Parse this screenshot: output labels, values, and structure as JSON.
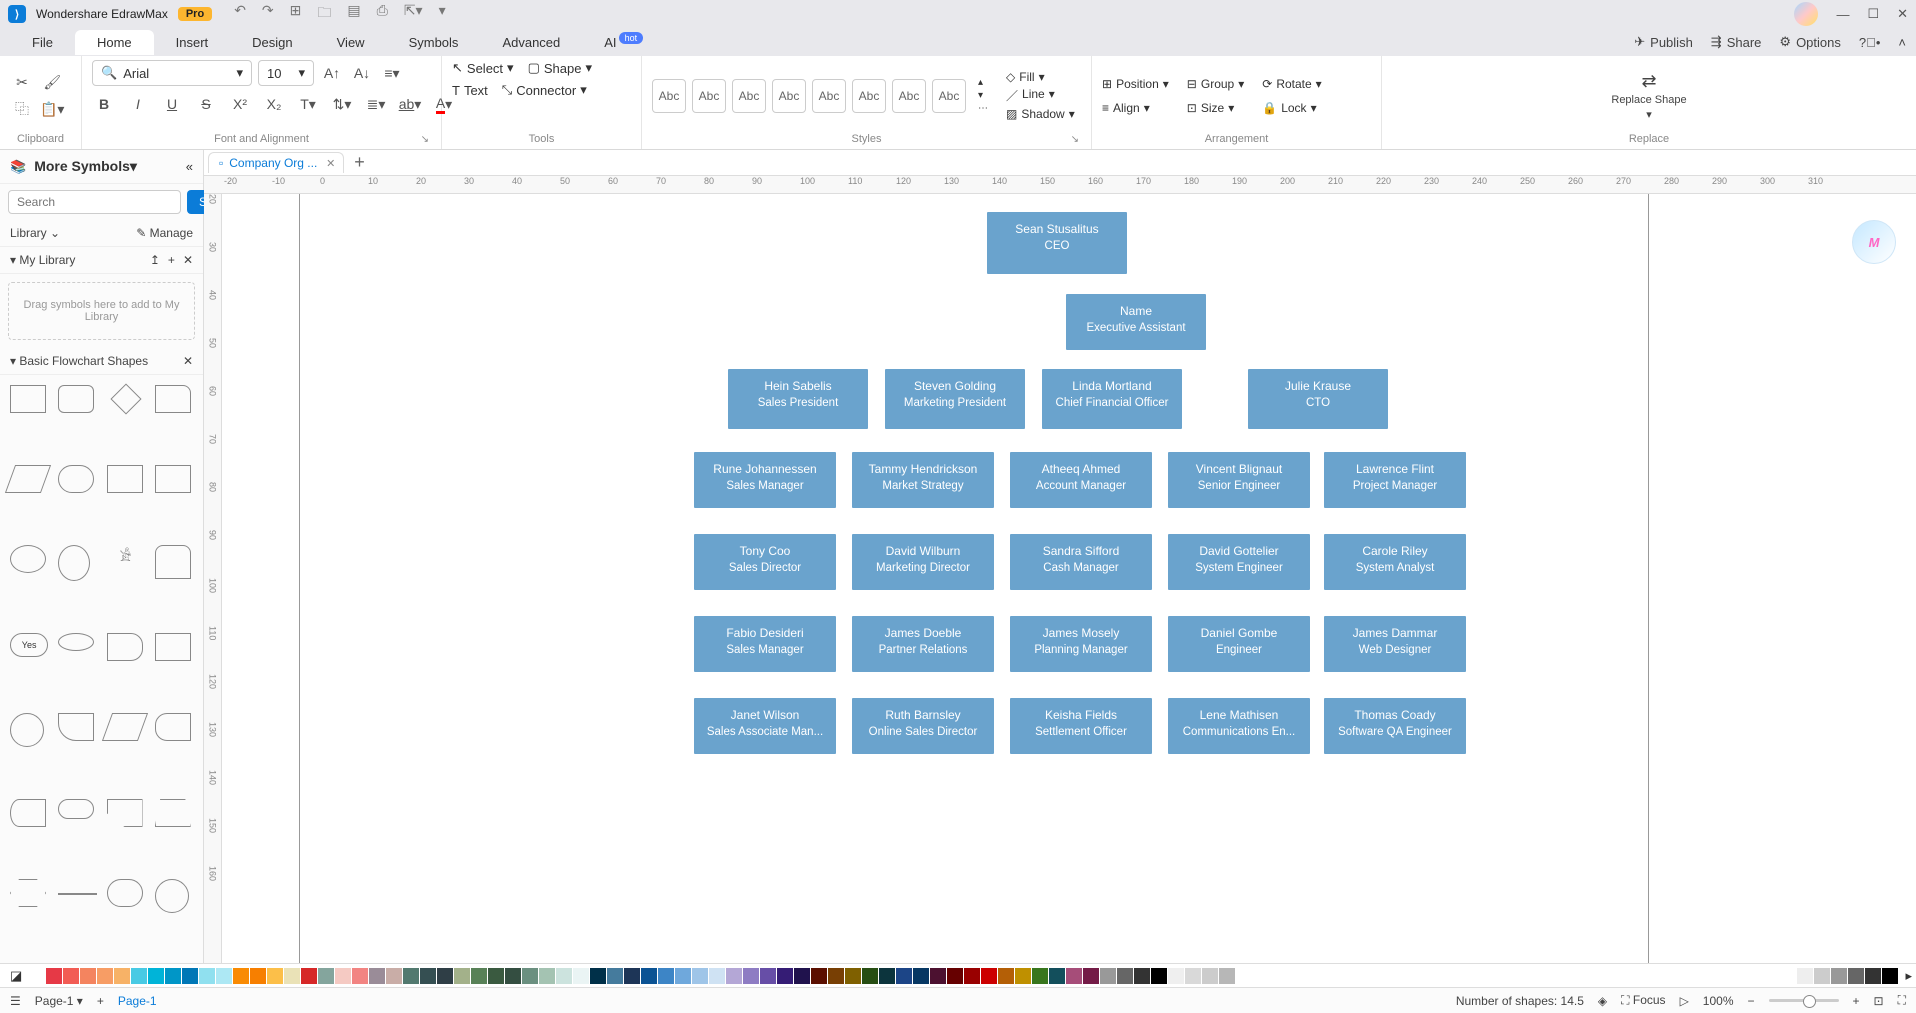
{
  "app": {
    "title": "Wondershare EdrawMax",
    "pro": "Pro"
  },
  "menu": {
    "items": [
      "File",
      "Home",
      "Insert",
      "Design",
      "View",
      "Symbols",
      "Advanced",
      "AI"
    ],
    "active": "Home",
    "hot": "hot",
    "right": {
      "publish": "Publish",
      "share": "Share",
      "options": "Options"
    }
  },
  "ribbon": {
    "clipboard": "Clipboard",
    "font_align": "Font and Alignment",
    "tools": "Tools",
    "styles": "Styles",
    "arrangement": "Arrangement",
    "replace": "Replace",
    "font_name": "Arial",
    "font_size": "10",
    "select": "Select",
    "shape": "Shape",
    "text": "Text",
    "connector": "Connector",
    "abc": "Abc",
    "fill": "Fill",
    "line": "Line",
    "shadow": "Shadow",
    "position": "Position",
    "align": "Align",
    "group": "Group",
    "size": "Size",
    "rotate": "Rotate",
    "lock": "Lock",
    "replace_shape": "Replace Shape"
  },
  "leftpanel": {
    "more_symbols": "More Symbols",
    "search_ph": "Search",
    "search_btn": "Search",
    "library": "Library",
    "manage": "Manage",
    "my_library": "My Library",
    "drop_hint": "Drag symbols here to add to My Library",
    "basic_shapes": "Basic Flowchart Shapes"
  },
  "tabs": {
    "t0": "Company Org ..."
  },
  "ruler_h": [
    "-20",
    "-10",
    "0",
    "10",
    "20",
    "30",
    "40",
    "50",
    "60",
    "70",
    "80",
    "90",
    "100",
    "110",
    "120",
    "130",
    "140",
    "150",
    "160",
    "170",
    "180",
    "190",
    "200",
    "210",
    "220",
    "230",
    "240",
    "250",
    "260",
    "270",
    "280",
    "290",
    "300",
    "310"
  ],
  "ruler_v": [
    "20",
    "30",
    "40",
    "50",
    "60",
    "70",
    "80",
    "90",
    "100",
    "110",
    "120",
    "130",
    "140",
    "150",
    "160"
  ],
  "org": {
    "ceo": {
      "name": "Sean Stusalitus",
      "role": "CEO"
    },
    "ea": {
      "name": "Name",
      "role": "Executive Assistant"
    },
    "l2": [
      {
        "name": "Hein Sabelis",
        "role": "Sales President"
      },
      {
        "name": "Steven Golding",
        "role": "Marketing President"
      },
      {
        "name": "Linda Mortland",
        "role": "Chief Financial Officer"
      },
      {
        "name": "Julie Krause",
        "role": "CTO"
      }
    ],
    "l3": [
      [
        {
          "name": "Rune Johannessen",
          "role": "Sales Manager"
        },
        {
          "name": "Tony Coo",
          "role": "Sales Director"
        },
        {
          "name": "Fabio Desideri",
          "role": "Sales Manager"
        },
        {
          "name": "Janet Wilson",
          "role": "Sales Associate Man..."
        }
      ],
      [
        {
          "name": "Tammy Hendrickson",
          "role": "Market Strategy"
        },
        {
          "name": "David Wilburn",
          "role": "Marketing Director"
        },
        {
          "name": "James Doeble",
          "role": "Partner Relations"
        },
        {
          "name": "Ruth Barnsley",
          "role": "Online Sales Director"
        }
      ],
      [
        {
          "name": "Atheeq Ahmed",
          "role": "Account Manager"
        },
        {
          "name": "Sandra Sifford",
          "role": "Cash Manager"
        },
        {
          "name": "James Mosely",
          "role": "Planning Manager"
        },
        {
          "name": "Keisha Fields",
          "role": "Settlement Officer"
        }
      ],
      [
        {
          "name": "Vincent Blignaut",
          "role": "Senior Engineer"
        },
        {
          "name": "David Gottelier",
          "role": "System Engineer"
        },
        {
          "name": "Daniel Gombe",
          "role": "Engineer"
        },
        {
          "name": "Lene Mathisen",
          "role": "Communications En..."
        }
      ],
      [
        {
          "name": "Lawrence Flint",
          "role": "Project Manager"
        },
        {
          "name": "Carole Riley",
          "role": "System Analyst"
        },
        {
          "name": "James Dammar",
          "role": "Web Designer"
        },
        {
          "name": "Thomas Coady",
          "role": "Software QA Engineer"
        }
      ]
    ]
  },
  "colors": [
    "#ffffff",
    "#e63946",
    "#f25c54",
    "#f4845f",
    "#f79d65",
    "#f7b267",
    "#48cae4",
    "#00b4d8",
    "#0096c7",
    "#0077b6",
    "#90e0ef",
    "#ade8f4",
    "#f98b04",
    "#f77f00",
    "#fcbf49",
    "#eae2b7",
    "#d62828",
    "#84a59d",
    "#f5cac3",
    "#f28482",
    "#9a8c98",
    "#c9ada7",
    "#52796f",
    "#354f52",
    "#2f3e46",
    "#a3b18a",
    "#588157",
    "#3a5a40",
    "#344e41",
    "#6b9080",
    "#a4c3b2",
    "#cce3de",
    "#eaf4f4",
    "#003049",
    "#457b9d",
    "#1d3557",
    "#0b5394",
    "#3d85c6",
    "#6fa8dc",
    "#9fc5e8",
    "#cfe2f3",
    "#b4a7d6",
    "#8e7cc3",
    "#674ea7",
    "#351c75",
    "#20124d",
    "#5b0f00",
    "#783f04",
    "#7f6000",
    "#274e13",
    "#0c343d",
    "#1c4587",
    "#073763",
    "#4c1130",
    "#660000",
    "#990000",
    "#cc0000",
    "#b45f06",
    "#bf9000",
    "#38761d",
    "#134f5c",
    "#a64d79",
    "#741b47",
    "#999999",
    "#666666",
    "#333333",
    "#000000",
    "#efefef",
    "#d9d9d9",
    "#cccccc",
    "#b7b7b7"
  ],
  "status": {
    "page_btn": "Page-1",
    "page_active": "Page-1",
    "shapes": "Number of shapes: 14.5",
    "focus": "Focus",
    "zoom": "100%"
  }
}
